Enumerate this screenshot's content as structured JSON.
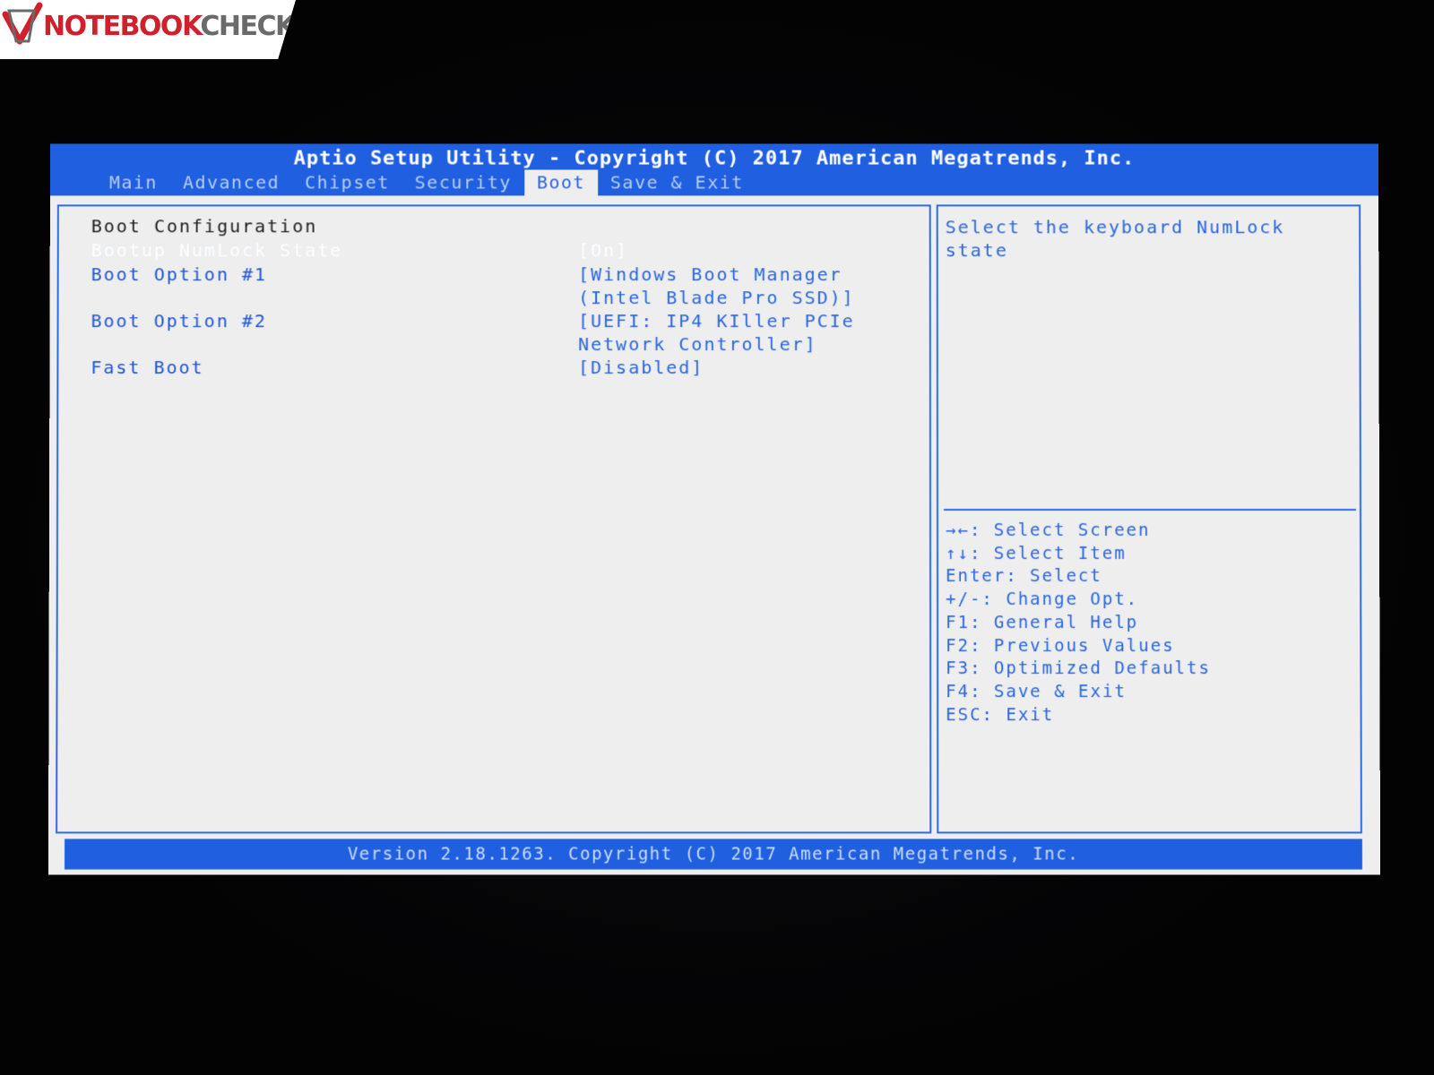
{
  "watermark": {
    "brand": "NOTEBOOK",
    "brand_suffix": "CHECK"
  },
  "header": {
    "title": "Aptio Setup Utility - Copyright (C) 2017 American Megatrends, Inc.",
    "tabs": [
      {
        "label": "Main"
      },
      {
        "label": "Advanced"
      },
      {
        "label": "Chipset"
      },
      {
        "label": "Security"
      },
      {
        "label": "Boot",
        "active": true
      },
      {
        "label": "Save & Exit"
      }
    ]
  },
  "settings": {
    "heading": "Boot Configuration",
    "items": [
      {
        "label": "Bootup NumLock State",
        "value": "[On]",
        "selected": true
      },
      {
        "label": "Boot Option #1",
        "value_line1": "[Windows Boot Manager",
        "value_line2": "(Intel Blade Pro SSD)]"
      },
      {
        "label": "Boot Option #2",
        "value_line1": "[UEFI: IP4 KIller PCIe",
        "value_line2": "Network Controller]"
      },
      {
        "label": "Fast Boot",
        "value": "[Disabled]"
      }
    ]
  },
  "help": {
    "text": "Select the keyboard NumLock state"
  },
  "keys": [
    "→←: Select Screen",
    "↑↓: Select Item",
    "Enter: Select",
    "+/-: Change Opt.",
    "F1: General Help",
    "F2: Previous Values",
    "F3: Optimized Defaults",
    "F4: Save & Exit",
    "ESC: Exit"
  ],
  "footer": {
    "text": "Version 2.18.1263. Copyright (C) 2017 American Megatrends, Inc."
  },
  "colors": {
    "bios_blue": "#1f5fe0",
    "panel_bg": "#eeeeee",
    "brand_red": "#d1202b"
  }
}
